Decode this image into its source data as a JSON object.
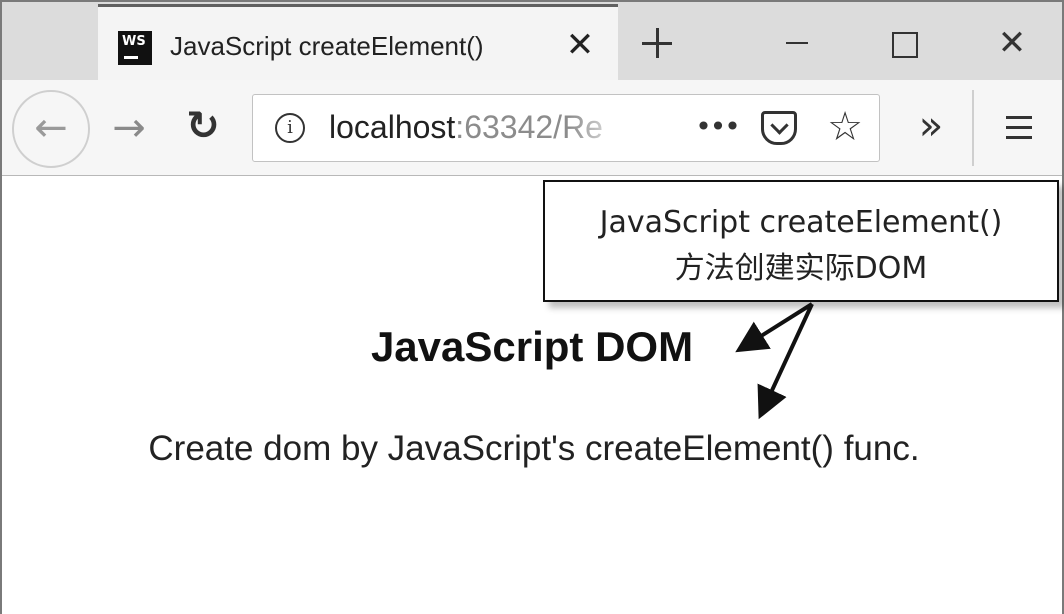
{
  "tab": {
    "favicon_text": "WS",
    "title": "JavaScript createElement()",
    "close_glyph": "✕"
  },
  "window_controls": {
    "minimize": "",
    "maximize": "",
    "close_glyph": "✕"
  },
  "nav": {
    "back_glyph": "←",
    "forward_glyph": "→",
    "reload_glyph": "↻",
    "overflow_glyph": "»",
    "url_host": "localhost",
    "url_rest": ":63342/Re",
    "more_glyph": "•••",
    "star_glyph": "☆"
  },
  "page": {
    "heading": "JavaScript DOM",
    "paragraph": "Create dom by JavaScript's createElement() func."
  },
  "callout": {
    "line1": "JavaScript  createElement()",
    "line2": "方法创建实际DOM"
  },
  "icons": [
    "back-arrow-icon",
    "forward-arrow-icon",
    "reload-icon",
    "info-icon",
    "more-icon",
    "pocket-icon",
    "star-icon",
    "overflow-icon",
    "hamburger-menu-icon",
    "new-tab-icon",
    "close-icon"
  ]
}
